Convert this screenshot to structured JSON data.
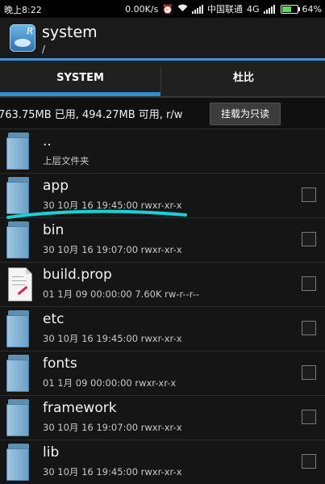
{
  "status_bar": {
    "time": "晚上8:22",
    "net_speed": "0.00K/s",
    "carrier": "中国联通",
    "network_type": "4G",
    "battery": "64%",
    "battery_fraction": 0.64
  },
  "app": {
    "title": "system",
    "path": "/"
  },
  "tabs": [
    {
      "label": "SYSTEM",
      "active": true
    },
    {
      "label": "杜比",
      "active": false
    }
  ],
  "info": {
    "storage": "763.75MB 已用, 494.27MB 可用, r/w",
    "mount_button": "挂载为只读"
  },
  "files": [
    {
      "name": "..",
      "meta": "上层文件夹",
      "icon": "folder-icon",
      "checkbox": false
    },
    {
      "name": "app",
      "meta": "30 10月 16 19:45:00    rwxr-xr-x",
      "icon": "folder-icon",
      "checkbox": true
    },
    {
      "name": "bin",
      "meta": "30 10月 16 19:07:00    rwxr-xr-x",
      "icon": "folder-icon",
      "checkbox": true
    },
    {
      "name": "build.prop",
      "meta": "01 1月 09 00:00:00  7.60K  rw-r--r--",
      "icon": "file-icon",
      "checkbox": true
    },
    {
      "name": "etc",
      "meta": "30 10月 16 19:45:00    rwxr-xr-x",
      "icon": "folder-icon",
      "checkbox": true
    },
    {
      "name": "fonts",
      "meta": "01 1月 09 00:00:00    rwxr-xr-x",
      "icon": "folder-icon",
      "checkbox": true
    },
    {
      "name": "framework",
      "meta": "30 10月 16 19:07:00    rwxr-xr-x",
      "icon": "folder-icon",
      "checkbox": true
    },
    {
      "name": "lib",
      "meta": "30 10月 16 19:45:00    rwxr-xr-x",
      "icon": "folder-icon",
      "checkbox": true
    }
  ],
  "colors": {
    "accent": "#3a96d8",
    "annotation": "#19d2d6"
  }
}
